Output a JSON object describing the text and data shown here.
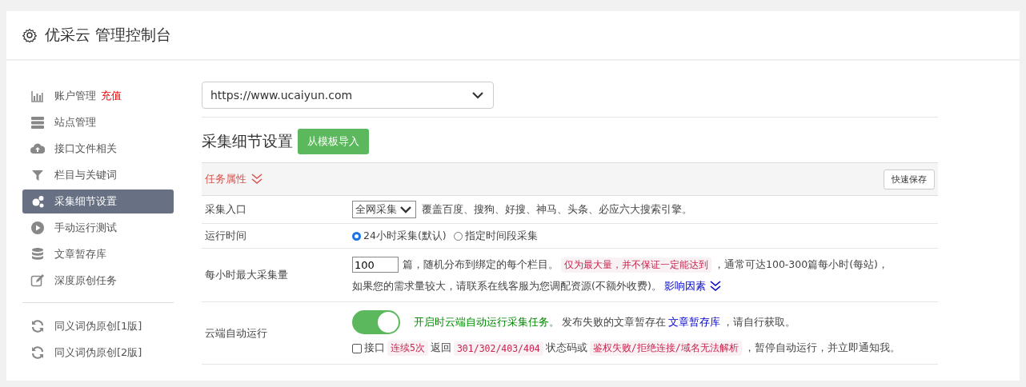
{
  "header": {
    "title": "优采云 管理控制台"
  },
  "sidebar": {
    "groups": [
      [
        {
          "label": "账户管理",
          "badge": "充值",
          "selected": false
        },
        {
          "label": "站点管理",
          "selected": false
        },
        {
          "label": "接口文件相关",
          "selected": false
        },
        {
          "label": "栏目与关键词",
          "selected": false
        },
        {
          "label": "采集细节设置",
          "selected": true
        },
        {
          "label": "手动运行测试",
          "selected": false
        },
        {
          "label": "文章暂存库",
          "selected": false
        },
        {
          "label": "深度原创任务",
          "selected": false
        }
      ],
      [
        {
          "label": "同义词伪原创[1版]",
          "selected": false
        },
        {
          "label": "同义词伪原创[2版]",
          "selected": false
        }
      ]
    ]
  },
  "site_select": {
    "value": "https://www.ucaiyun.com"
  },
  "section": {
    "title": "采集细节设置",
    "import_button": "从模板导入"
  },
  "panel": {
    "title": "任务属性",
    "save_button": "快速保存",
    "rows": [
      {
        "kind": "select",
        "label": "采集入口",
        "value": "全网采集",
        "lines": [
          [
            {
              "kind": "plain",
              "text": "覆盖百度、搜狗、好搜、神马、头条、必应六大搜索引擎。"
            }
          ]
        ]
      },
      {
        "kind": "radio",
        "label": "运行时间",
        "options": [
          {
            "label": "24小时采集(默认)",
            "selected": true
          },
          {
            "label": "指定时间段采集",
            "selected": false
          }
        ]
      },
      {
        "kind": "number",
        "label": "每小时最大采集量",
        "value": "100",
        "lines": [
          [
            {
              "kind": "plain",
              "text": "篇，随机分布到绑定的每个栏目。"
            },
            {
              "kind": "code",
              "text": "仅为最大量，并不保证一定能达到"
            },
            {
              "kind": "plain",
              "text": "，通常可达100-300篇每小时(每站)，"
            }
          ],
          [
            {
              "kind": "plain",
              "text": "如果您的需求量较大，请联系在线客服为您调配资源(不额外收费)。"
            },
            {
              "kind": "link",
              "text": "影响因素",
              "chevron": true
            }
          ]
        ]
      },
      {
        "kind": "toggle",
        "label": "云端自动运行",
        "on": true,
        "checked": false,
        "lines": [
          [
            {
              "kind": "green",
              "text": "开启时云端自动运行采集任务。"
            },
            {
              "kind": "plain",
              "text": "发布失败的文章暂存在"
            },
            {
              "kind": "link",
              "text": "文章暂存库"
            },
            {
              "kind": "plain",
              "text": "，请自行获取。"
            }
          ],
          [
            {
              "kind": "plain",
              "text": "接口"
            },
            {
              "kind": "code",
              "text": "连续5次"
            },
            {
              "kind": "plain",
              "text": "返回"
            },
            {
              "kind": "code",
              "text": "301/302/403/404"
            },
            {
              "kind": "plain",
              "text": "状态码或"
            },
            {
              "kind": "code",
              "text": "鉴权失败/拒绝连接/域名无法解析"
            },
            {
              "kind": "plain",
              "text": "，暂停自动运行，并立即通知我。"
            }
          ]
        ]
      }
    ]
  }
}
